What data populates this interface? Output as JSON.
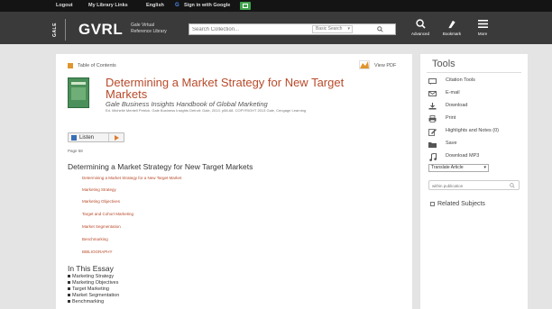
{
  "topbar": {
    "logout": "Logout",
    "my_library_links": "My Library Links",
    "language": "English",
    "google_signin": "Sign in with Google"
  },
  "header": {
    "brand_vertical": "GALE",
    "brand": "GVRL",
    "brand_sub": "Gale Virtual Reference Library",
    "search_placeholder": "Search Collection...",
    "search_type": "Basic Search",
    "tools": {
      "advanced": "Advanced",
      "bookmark": "Bookmark",
      "more": "More"
    }
  },
  "content": {
    "toc_label": "Table of Contents",
    "view_pdf": "View PDF",
    "title": "Determining a Market Strategy for New Target Markets",
    "source": "Gale Business Insights Handbook of Global Marketing",
    "citation": "Ed. Michelle Mentell Petrick. Gale Business Insights Detroit: Gale, 2013. p58-68. COPYRIGHT 2013 Gale, Cengage Learning",
    "listen": "Listen",
    "page_label": "Page 58",
    "section_heading": "Determining a Market Strategy for New Target Markets",
    "subsections": [
      "Determining a Market Strategy for a New Target Market",
      "Marketing Strategy",
      "Marketing Objectives",
      "Target and Cohort Marketing",
      "Market Segmentation",
      "Benchmarking",
      "BIBLIOGRAPHY"
    ],
    "essay_heading": "In This Essay",
    "essay_items": [
      "Marketing Strategy",
      "Marketing Objectives",
      "Target Marketing",
      "Market Segmentation",
      "Benchmarking"
    ]
  },
  "tools_panel": {
    "title": "Tools",
    "items": [
      {
        "label": "Citation Tools",
        "icon": "citation-icon"
      },
      {
        "label": "E-mail",
        "icon": "email-icon"
      },
      {
        "label": "Download",
        "icon": "download-icon"
      },
      {
        "label": "Print",
        "icon": "print-icon"
      },
      {
        "label": "Highlights and Notes (0)",
        "icon": "highlight-icon"
      },
      {
        "label": "Save",
        "icon": "save-icon"
      },
      {
        "label": "Download MP3",
        "icon": "music-icon"
      }
    ],
    "translate": "Translate Article",
    "within_placeholder": "within publication",
    "related_subjects": "Related Subjects"
  },
  "colors": {
    "accent": "#b84a2a",
    "header_bg": "#3a3a3a",
    "topbar_bg": "#141414",
    "page_bg": "#e4e4e4"
  }
}
